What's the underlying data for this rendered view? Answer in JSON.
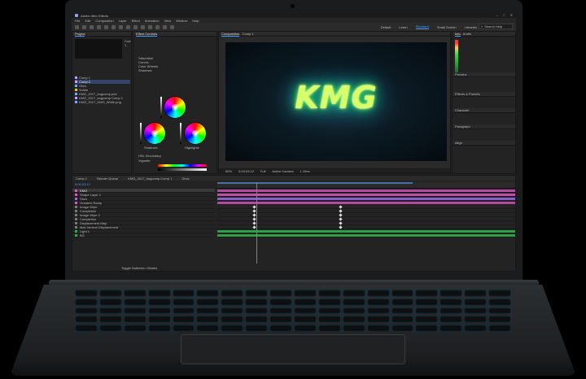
{
  "app": {
    "title": "Adobe After Effects",
    "window_controls": [
      "–",
      "□",
      "✕"
    ],
    "menus": [
      "File",
      "Edit",
      "Composition",
      "Layer",
      "Effect",
      "Animation",
      "View",
      "Window",
      "Help"
    ],
    "workspaces": [
      "Default",
      "Learn",
      "Standard",
      "Small Screen",
      "Libraries"
    ],
    "active_workspace": "Standard",
    "search_placeholder": "Search Help"
  },
  "project": {
    "tab": "Project",
    "comp_name": "Comp 1",
    "items": [
      {
        "name": "Comp 1",
        "color": "#c4a0ff",
        "selected": false
      },
      {
        "name": "Comp 2",
        "color": "#c4a0ff",
        "selected": true
      },
      {
        "name": "Glow",
        "color": "#77aaff",
        "selected": false
      },
      {
        "name": "Solids",
        "color": "#e5c34b",
        "selected": false
      },
      {
        "name": "KMG_2017_bugcomp.psd",
        "color": "#77aaff",
        "selected": false
      },
      {
        "name": "KMG_2017_bugcomp Comp 1",
        "color": "#c4a0ff",
        "selected": false
      },
      {
        "name": "KMG_2017_KMG_White.png",
        "color": "#77aaff",
        "selected": false
      }
    ]
  },
  "effect_controls": {
    "tab": "Effect Controls",
    "sections": [
      "Saturation",
      "Curves",
      "Color Wheels",
      "Shadows",
      "HSL Secondary",
      "Vignette"
    ],
    "wheel_labels": [
      "Shadows",
      "Highlights",
      "Midtones"
    ]
  },
  "composition": {
    "tab": "Composition",
    "comp_tab": "Comp 1",
    "title_text": "KMG",
    "zoom": "50%",
    "timecode": "0;00;03;12",
    "resolution": "Full",
    "camera": "Active Camera",
    "views": "1 View"
  },
  "right_panels": {
    "info": "Info",
    "audio": "Audio",
    "preview": "Preview",
    "effects": "Effects & Presets",
    "align": "Align",
    "character": "Character",
    "paragraph": "Paragraph"
  },
  "timeline": {
    "tabs": [
      "Comp 1",
      "Render Queue",
      "KMG_2017_bugcomp Comp 1",
      "Glow"
    ],
    "timecode": "0;00;03;12",
    "layers": [
      {
        "name": "KMG",
        "color": "#d65cb8",
        "bar": "#b44aa0",
        "selected": true
      },
      {
        "name": "Shape Layer 1",
        "color": "#d65cb8",
        "bar": "#c04fa8",
        "selected": false
      },
      {
        "name": "Glow",
        "color": "#9b6bdc",
        "bar": "#8b5fcf",
        "selected": false
      },
      {
        "name": "Gradient Ramp",
        "color": "#d65cb8",
        "bar": "#b44aa0",
        "selected": false
      },
      {
        "name": "Image Wipe",
        "color": "#7a7a7a",
        "bar": "",
        "selected": false
      },
      {
        "name": "Completion",
        "color": "#7a7a7a",
        "bar": "",
        "selected": false
      },
      {
        "name": "Image Wipe 2",
        "color": "#7a7a7a",
        "bar": "",
        "selected": false
      },
      {
        "name": "Completion",
        "color": "#7a7a7a",
        "bar": "",
        "selected": false
      },
      {
        "name": "Displacement Map",
        "color": "#7a7a7a",
        "bar": "",
        "selected": false
      },
      {
        "name": "Max Vertical Displacement",
        "color": "#7a7a7a",
        "bar": "",
        "selected": false
      },
      {
        "name": "Light 1",
        "color": "#3aa64b",
        "bar": "#2f9e44",
        "selected": false
      },
      {
        "name": "BG",
        "color": "#3aa64b",
        "bar": "#2f9e44",
        "selected": false
      }
    ],
    "toggle_label": "Toggle Switches / Modes"
  }
}
